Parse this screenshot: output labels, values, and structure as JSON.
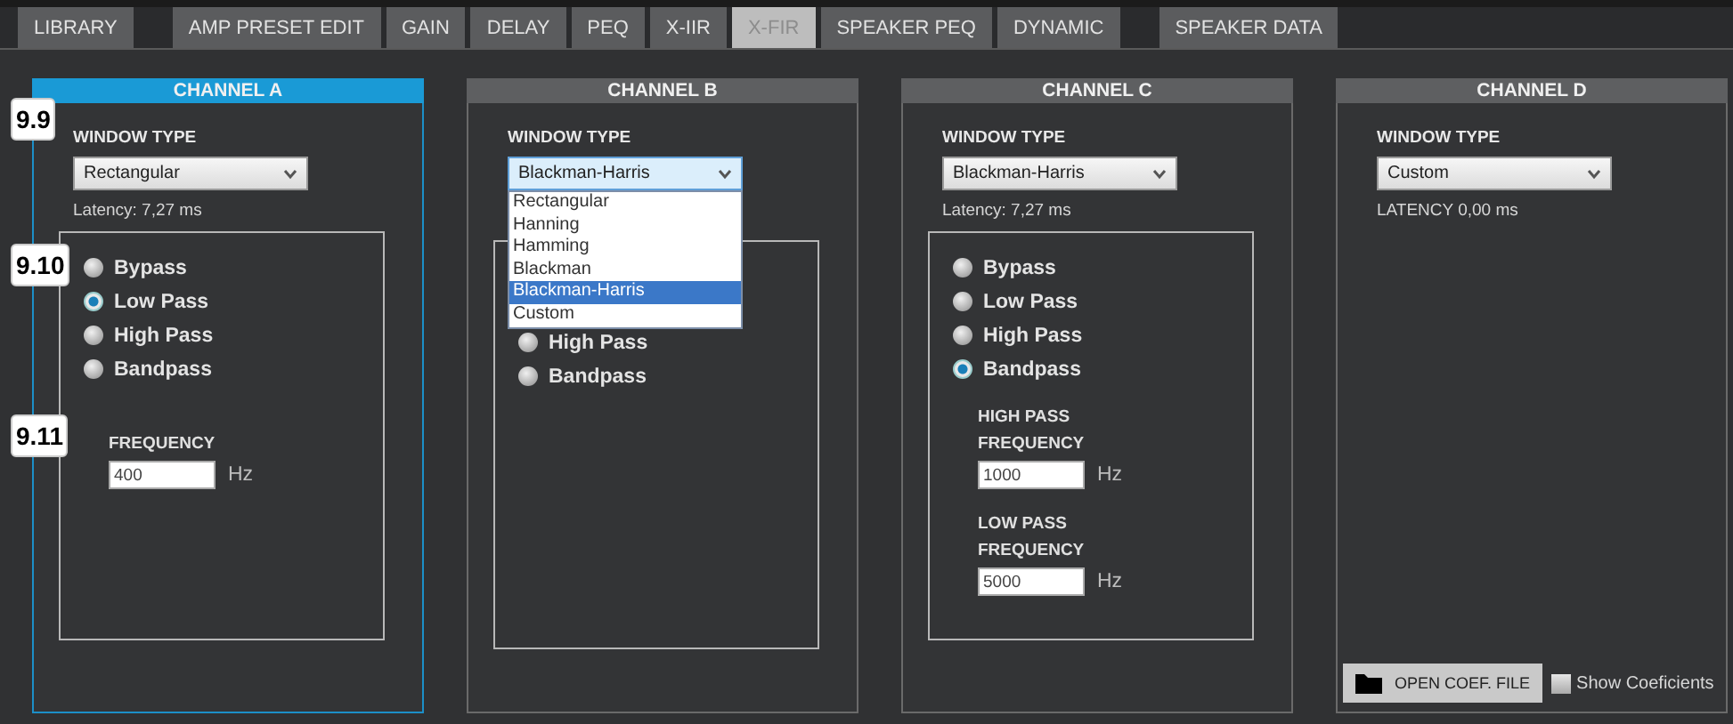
{
  "tabs": [
    {
      "label": "LIBRARY",
      "selected": false
    },
    {
      "label": "AMP PRESET EDIT",
      "selected": false
    },
    {
      "label": "GAIN",
      "selected": false
    },
    {
      "label": "DELAY",
      "selected": false
    },
    {
      "label": "PEQ",
      "selected": false
    },
    {
      "label": "X-IIR",
      "selected": false
    },
    {
      "label": "X-FIR",
      "selected": true
    },
    {
      "label": "SPEAKER PEQ",
      "selected": false
    },
    {
      "label": "DYNAMIC",
      "selected": false
    },
    {
      "label": "SPEAKER DATA",
      "selected": false
    }
  ],
  "channels": [
    {
      "title": "CHANNEL A",
      "active": true,
      "window_type": {
        "label": "WINDOW TYPE",
        "value": "Rectangular",
        "open": false,
        "callout": "9.9"
      },
      "latency": "Latency: 7,27 ms",
      "filter": {
        "callout": "9.10",
        "options": [
          {
            "label": "Bypass",
            "checked": false
          },
          {
            "label": "Low Pass",
            "checked": true
          },
          {
            "label": "High Pass",
            "checked": false
          },
          {
            "label": "Bandpass",
            "checked": false
          }
        ]
      },
      "frequencies": [
        {
          "label": "FREQUENCY",
          "value": "400",
          "unit": "Hz",
          "callout": "9.11"
        }
      ]
    },
    {
      "title": "CHANNEL B",
      "active": false,
      "window_type": {
        "label": "WINDOW TYPE",
        "value": "Blackman-Harris",
        "open": true,
        "options": [
          {
            "label": "Rectangular",
            "selected": false
          },
          {
            "label": "Hanning",
            "selected": false
          },
          {
            "label": "Hamming",
            "selected": false
          },
          {
            "label": "Blackman",
            "selected": false
          },
          {
            "label": "Blackman-Harris",
            "selected": true
          },
          {
            "label": "Custom",
            "selected": false
          }
        ]
      },
      "filter": {
        "options": [
          {
            "label": "High Pass",
            "checked": false
          },
          {
            "label": "Bandpass",
            "checked": false
          }
        ]
      }
    },
    {
      "title": "CHANNEL C",
      "active": false,
      "window_type": {
        "label": "WINDOW TYPE",
        "value": "Blackman-Harris",
        "open": false
      },
      "latency": "Latency: 7,27 ms",
      "filter": {
        "options": [
          {
            "label": "Bypass",
            "checked": false
          },
          {
            "label": "Low Pass",
            "checked": false
          },
          {
            "label": "High Pass",
            "checked": false
          },
          {
            "label": "Bandpass",
            "checked": true
          }
        ]
      },
      "frequencies": [
        {
          "label": "HIGH PASS FREQUENCY",
          "value": "1000",
          "unit": "Hz"
        },
        {
          "label": "LOW PASS FREQUENCY",
          "value": "5000",
          "unit": "Hz"
        }
      ]
    },
    {
      "title": "CHANNEL D",
      "active": false,
      "window_type": {
        "label": "WINDOW TYPE",
        "value": "Custom",
        "open": false
      },
      "latency": "LATENCY 0,00 ms",
      "open_file_button": "OPEN COEF. FILE",
      "show_coefficients": {
        "label": "Show Coeficients",
        "checked": false
      }
    }
  ]
}
